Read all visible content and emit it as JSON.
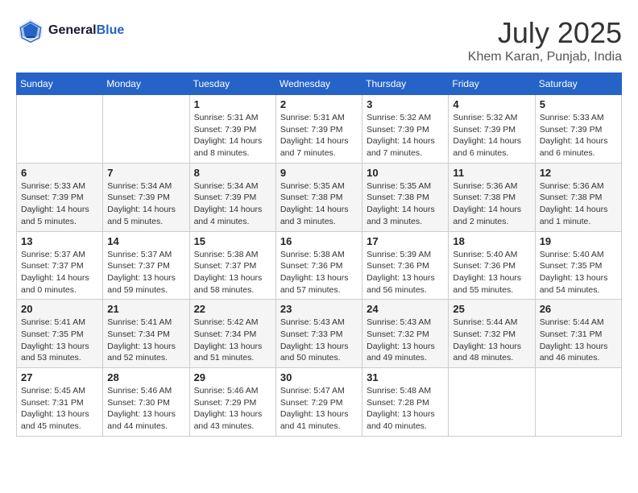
{
  "header": {
    "logo_line1": "General",
    "logo_line2": "Blue",
    "month": "July 2025",
    "location": "Khem Karan, Punjab, India"
  },
  "days_of_week": [
    "Sunday",
    "Monday",
    "Tuesday",
    "Wednesday",
    "Thursday",
    "Friday",
    "Saturday"
  ],
  "weeks": [
    [
      {
        "day": "",
        "info": ""
      },
      {
        "day": "",
        "info": ""
      },
      {
        "day": "1",
        "info": "Sunrise: 5:31 AM\nSunset: 7:39 PM\nDaylight: 14 hours\nand 8 minutes."
      },
      {
        "day": "2",
        "info": "Sunrise: 5:31 AM\nSunset: 7:39 PM\nDaylight: 14 hours\nand 7 minutes."
      },
      {
        "day": "3",
        "info": "Sunrise: 5:32 AM\nSunset: 7:39 PM\nDaylight: 14 hours\nand 7 minutes."
      },
      {
        "day": "4",
        "info": "Sunrise: 5:32 AM\nSunset: 7:39 PM\nDaylight: 14 hours\nand 6 minutes."
      },
      {
        "day": "5",
        "info": "Sunrise: 5:33 AM\nSunset: 7:39 PM\nDaylight: 14 hours\nand 6 minutes."
      }
    ],
    [
      {
        "day": "6",
        "info": "Sunrise: 5:33 AM\nSunset: 7:39 PM\nDaylight: 14 hours\nand 5 minutes."
      },
      {
        "day": "7",
        "info": "Sunrise: 5:34 AM\nSunset: 7:39 PM\nDaylight: 14 hours\nand 5 minutes."
      },
      {
        "day": "8",
        "info": "Sunrise: 5:34 AM\nSunset: 7:39 PM\nDaylight: 14 hours\nand 4 minutes."
      },
      {
        "day": "9",
        "info": "Sunrise: 5:35 AM\nSunset: 7:38 PM\nDaylight: 14 hours\nand 3 minutes."
      },
      {
        "day": "10",
        "info": "Sunrise: 5:35 AM\nSunset: 7:38 PM\nDaylight: 14 hours\nand 3 minutes."
      },
      {
        "day": "11",
        "info": "Sunrise: 5:36 AM\nSunset: 7:38 PM\nDaylight: 14 hours\nand 2 minutes."
      },
      {
        "day": "12",
        "info": "Sunrise: 5:36 AM\nSunset: 7:38 PM\nDaylight: 14 hours\nand 1 minute."
      }
    ],
    [
      {
        "day": "13",
        "info": "Sunrise: 5:37 AM\nSunset: 7:37 PM\nDaylight: 14 hours\nand 0 minutes."
      },
      {
        "day": "14",
        "info": "Sunrise: 5:37 AM\nSunset: 7:37 PM\nDaylight: 13 hours\nand 59 minutes."
      },
      {
        "day": "15",
        "info": "Sunrise: 5:38 AM\nSunset: 7:37 PM\nDaylight: 13 hours\nand 58 minutes."
      },
      {
        "day": "16",
        "info": "Sunrise: 5:38 AM\nSunset: 7:36 PM\nDaylight: 13 hours\nand 57 minutes."
      },
      {
        "day": "17",
        "info": "Sunrise: 5:39 AM\nSunset: 7:36 PM\nDaylight: 13 hours\nand 56 minutes."
      },
      {
        "day": "18",
        "info": "Sunrise: 5:40 AM\nSunset: 7:36 PM\nDaylight: 13 hours\nand 55 minutes."
      },
      {
        "day": "19",
        "info": "Sunrise: 5:40 AM\nSunset: 7:35 PM\nDaylight: 13 hours\nand 54 minutes."
      }
    ],
    [
      {
        "day": "20",
        "info": "Sunrise: 5:41 AM\nSunset: 7:35 PM\nDaylight: 13 hours\nand 53 minutes."
      },
      {
        "day": "21",
        "info": "Sunrise: 5:41 AM\nSunset: 7:34 PM\nDaylight: 13 hours\nand 52 minutes."
      },
      {
        "day": "22",
        "info": "Sunrise: 5:42 AM\nSunset: 7:34 PM\nDaylight: 13 hours\nand 51 minutes."
      },
      {
        "day": "23",
        "info": "Sunrise: 5:43 AM\nSunset: 7:33 PM\nDaylight: 13 hours\nand 50 minutes."
      },
      {
        "day": "24",
        "info": "Sunrise: 5:43 AM\nSunset: 7:32 PM\nDaylight: 13 hours\nand 49 minutes."
      },
      {
        "day": "25",
        "info": "Sunrise: 5:44 AM\nSunset: 7:32 PM\nDaylight: 13 hours\nand 48 minutes."
      },
      {
        "day": "26",
        "info": "Sunrise: 5:44 AM\nSunset: 7:31 PM\nDaylight: 13 hours\nand 46 minutes."
      }
    ],
    [
      {
        "day": "27",
        "info": "Sunrise: 5:45 AM\nSunset: 7:31 PM\nDaylight: 13 hours\nand 45 minutes."
      },
      {
        "day": "28",
        "info": "Sunrise: 5:46 AM\nSunset: 7:30 PM\nDaylight: 13 hours\nand 44 minutes."
      },
      {
        "day": "29",
        "info": "Sunrise: 5:46 AM\nSunset: 7:29 PM\nDaylight: 13 hours\nand 43 minutes."
      },
      {
        "day": "30",
        "info": "Sunrise: 5:47 AM\nSunset: 7:29 PM\nDaylight: 13 hours\nand 41 minutes."
      },
      {
        "day": "31",
        "info": "Sunrise: 5:48 AM\nSunset: 7:28 PM\nDaylight: 13 hours\nand 40 minutes."
      },
      {
        "day": "",
        "info": ""
      },
      {
        "day": "",
        "info": ""
      }
    ]
  ]
}
